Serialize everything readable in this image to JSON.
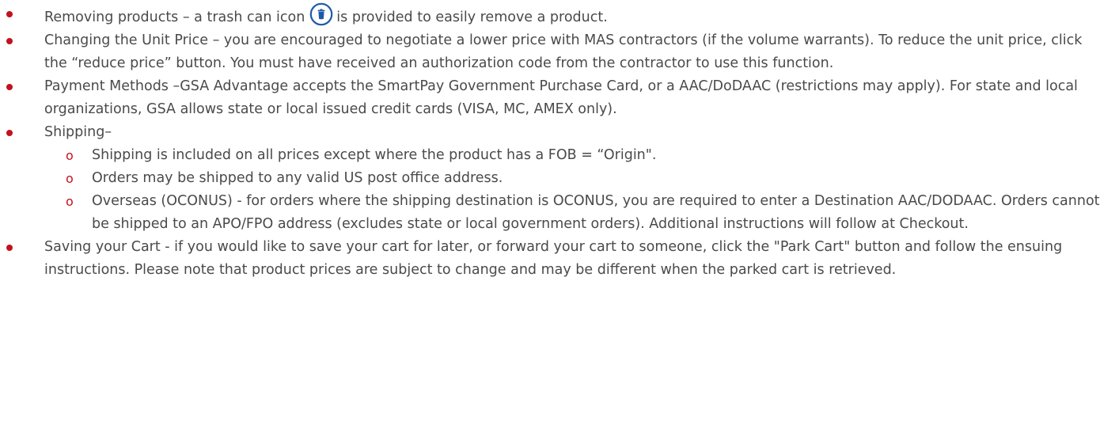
{
  "items": {
    "removing": {
      "before_icon": "Removing products – a trash can icon",
      "after_icon": "is provided to easily remove a product.",
      "icon": "trash-can-icon"
    },
    "unit_price": "Changing the Unit Price – you are encouraged to negotiate a lower price with MAS contractors (if the volume warrants).  To reduce the unit price, click the “reduce price” button. You must have received an authorization code from the contractor to use this function.",
    "payment": "Payment Methods –GSA Advantage accepts the SmartPay Government Purchase Card, or a AAC/DoDAAC (restrictions may apply).  For state and local organizations, GSA allows state or local issued credit cards (VISA, MC, AMEX only).",
    "shipping": {
      "label": "Shipping–",
      "sub_bullet": "o",
      "subitems": [
        "Shipping is included on all prices except where the product has a FOB = “Origin\".",
        "Orders may be shipped to any valid US post office address.",
        "Overseas (OCONUS) - for orders where the shipping destination is OCONUS, you are required to enter a Destination AAC/DODAAC. Orders cannot be shipped to an APO/FPO address (excludes state or local government orders).  Additional instructions will follow at Checkout."
      ]
    },
    "saving": "Saving your Cart - if you would like to save your cart for later, or forward your cart to someone, click the \"Park Cart\" button and follow the ensuing instructions.  Please note that product prices are subject to change and may be different when the parked cart is retrieved."
  },
  "colors": {
    "bullet": "#c1121f",
    "text": "#4a4a4a",
    "icon": "#1d5aa8"
  }
}
